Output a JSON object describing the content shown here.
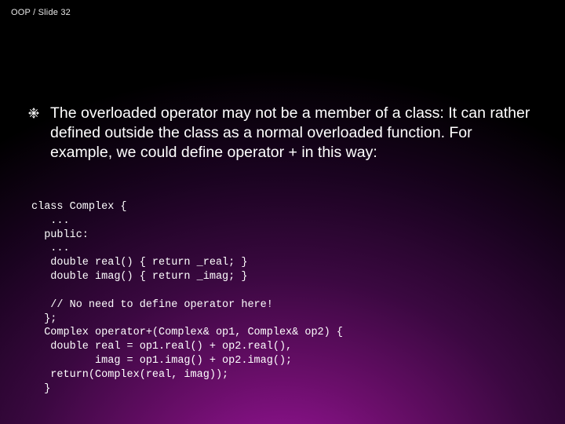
{
  "header": {
    "text": "OOP / Slide 32"
  },
  "bullet": {
    "icon": "snowflake-icon",
    "text": "The overloaded operator may not be a member of a class: It can rather defined outside the class as a normal overloaded function. For example, we could define operator + in this way:"
  },
  "code": "class Complex {\n   ...\n  public:\n   ...\n   double real() { return _real; }\n   double imag() { return _imag; }\n\n   // No need to define operator here!\n  };\n  Complex operator+(Complex& op1, Complex& op2) {\n   double real = op1.real() + op2.real(),\n          imag = op1.imag() + op2.imag();\n   return(Complex(real, imag));\n  }"
}
